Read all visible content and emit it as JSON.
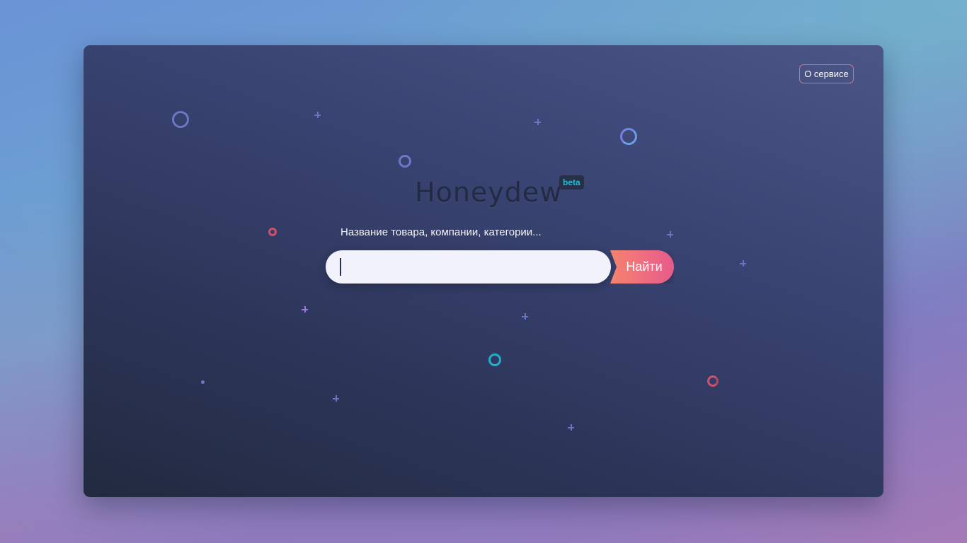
{
  "header": {
    "about_label": "О сервисе"
  },
  "brand": {
    "name": "Honeydew",
    "badge": "beta"
  },
  "search": {
    "hint": "Название товара, компании, категории...",
    "value": "",
    "placeholder": "",
    "button_label": "Найти"
  },
  "colors": {
    "accent_pink": "#ee6a82",
    "accent_coral": "#f4846e",
    "badge_text": "#28b8d4",
    "card_dark": "#222a40",
    "card_light": "#4b5687"
  },
  "decorations": [
    {
      "kind": "ring",
      "color": "#6c78c4"
    },
    {
      "kind": "plus",
      "color": "#6b74c0"
    },
    {
      "kind": "plus",
      "color": "#6b74c0"
    },
    {
      "kind": "ring",
      "color": "#6a9ee8"
    },
    {
      "kind": "ring",
      "color": "#6c78c4"
    },
    {
      "kind": "ring",
      "color": "#d0506e"
    },
    {
      "kind": "plus",
      "color": "#6b74c0"
    },
    {
      "kind": "plus",
      "color": "#6b74c0"
    },
    {
      "kind": "plus",
      "color": "#9a78e0"
    },
    {
      "kind": "plus",
      "color": "#6b74c0"
    },
    {
      "kind": "ring",
      "color": "#22b0c8"
    },
    {
      "kind": "dot",
      "color": "#6c78c4"
    },
    {
      "kind": "ring",
      "color": "#d0506e"
    },
    {
      "kind": "plus",
      "color": "#6b74c0"
    },
    {
      "kind": "plus",
      "color": "#6b74c0"
    }
  ]
}
